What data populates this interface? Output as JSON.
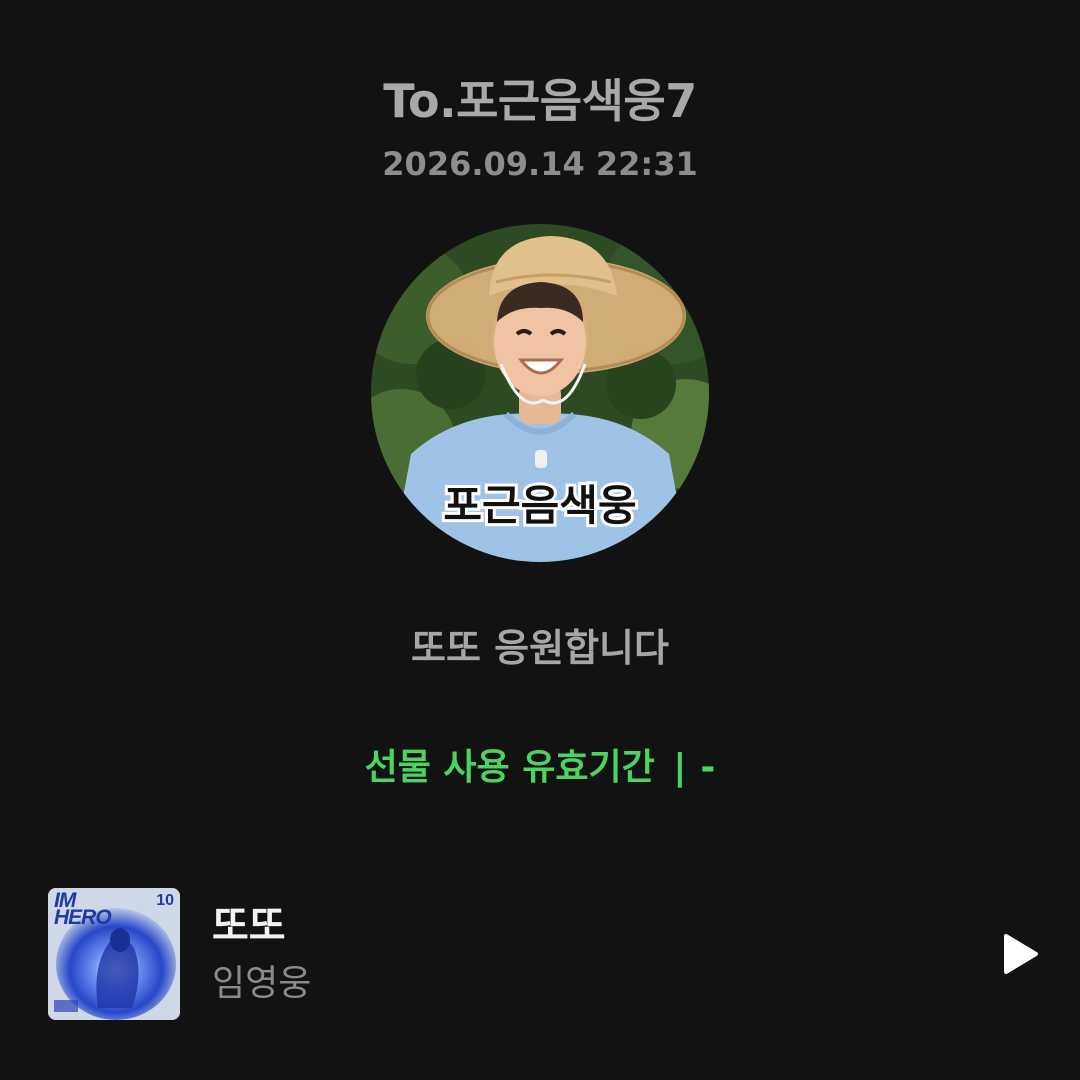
{
  "header": {
    "recipient": "To.포근음색웅7",
    "timestamp": "2026.09.14 22:31"
  },
  "avatar": {
    "caption": "포근음색웅"
  },
  "message": "또또 응원합니다",
  "gift_validity": {
    "label": "선물 사용 유효기간",
    "separator": "|",
    "value": "-"
  },
  "track": {
    "title": "또또",
    "artist": "임영웅",
    "album_art_text": "IM\nHERO",
    "album_art_number": "10",
    "play_icon": "play-icon"
  },
  "colors": {
    "background": "#121212",
    "accent_green": "#4cd460",
    "title_white": "#f2f2f2"
  }
}
